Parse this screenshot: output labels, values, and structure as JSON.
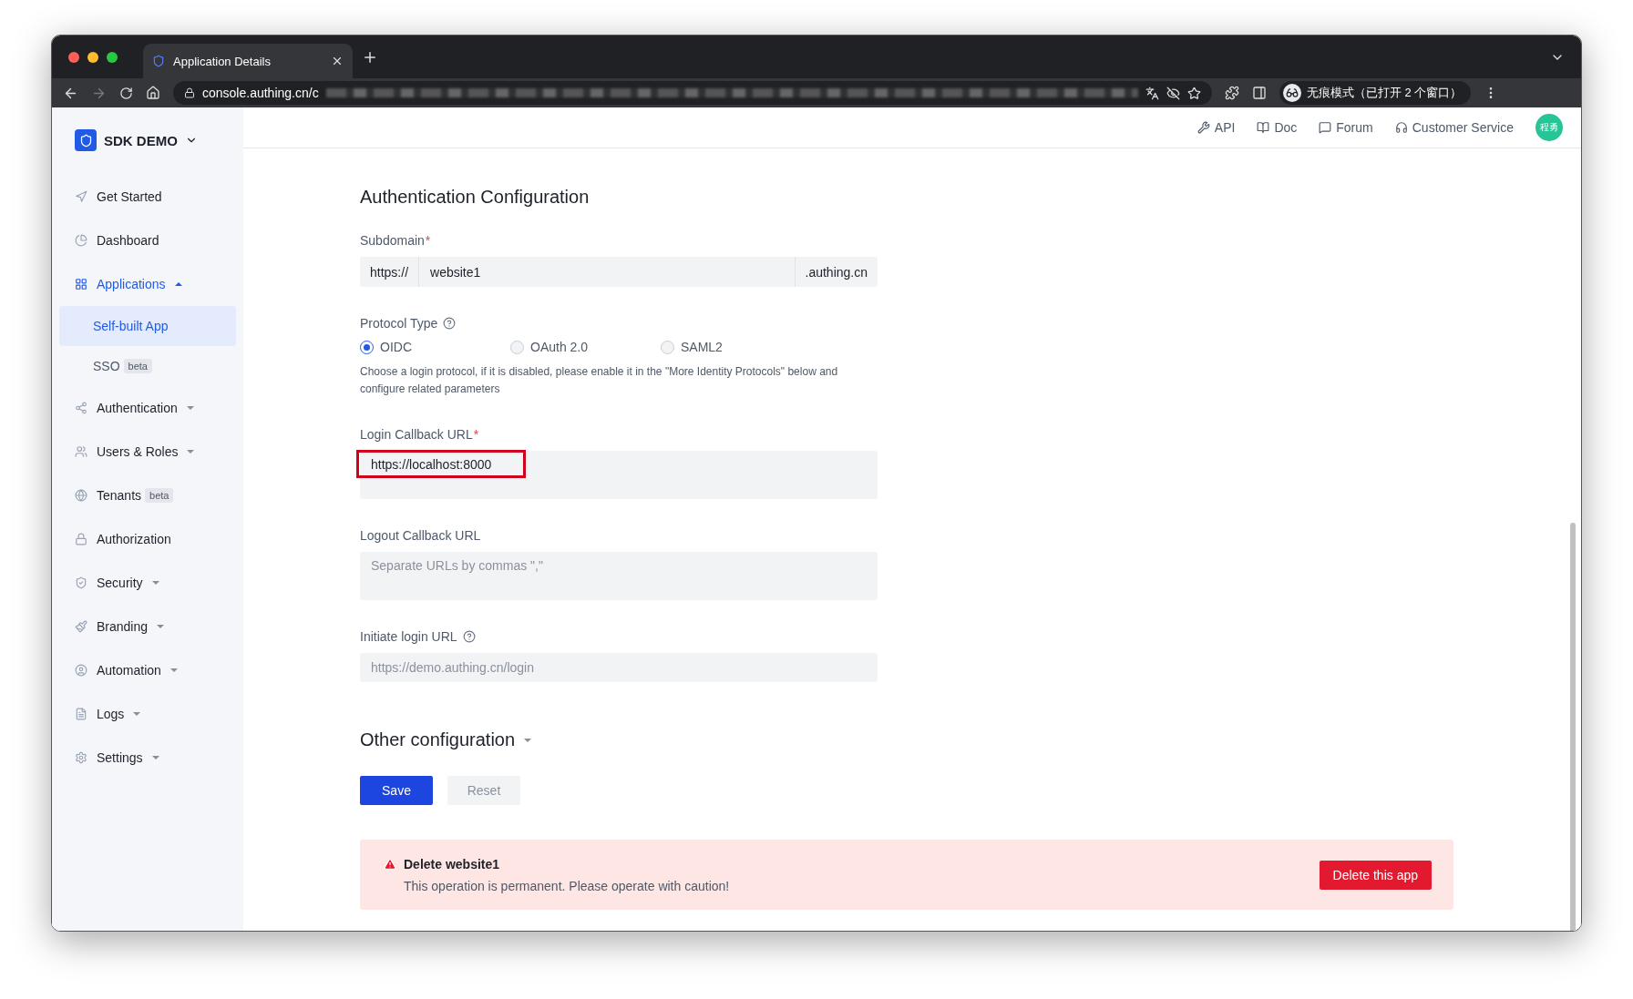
{
  "browser": {
    "tabs": [
      {
        "title": "Application Details",
        "selected": true
      }
    ],
    "url": "console.authing.cn/c",
    "profile_label": "无痕模式（已打开 2 个窗口）"
  },
  "sidebar": {
    "brand": "SDK DEMO",
    "items": [
      {
        "label": "Get Started",
        "selected": false
      },
      {
        "label": "Dashboard",
        "selected": false
      },
      {
        "label": "Applications",
        "selected": true,
        "expanded": true,
        "children": [
          {
            "label": "Self-built App",
            "selected": true
          },
          {
            "label": "SSO",
            "badge": "beta",
            "selected": false
          }
        ]
      },
      {
        "label": "Authentication",
        "selected": false,
        "expanded": false
      },
      {
        "label": "Users & Roles",
        "selected": false,
        "expanded": false
      },
      {
        "label": "Tenants",
        "badge": "beta",
        "selected": false
      },
      {
        "label": "Authorization",
        "selected": false
      },
      {
        "label": "Security",
        "selected": false,
        "expanded": false
      },
      {
        "label": "Branding",
        "selected": false,
        "expanded": false
      },
      {
        "label": "Automation",
        "selected": false,
        "expanded": false
      },
      {
        "label": "Logs",
        "selected": false,
        "expanded": false
      },
      {
        "label": "Settings",
        "selected": false,
        "expanded": false
      }
    ]
  },
  "header": {
    "links": [
      {
        "label": "API"
      },
      {
        "label": "Doc"
      },
      {
        "label": "Forum"
      },
      {
        "label": "Customer Service"
      }
    ],
    "avatar": "程勇"
  },
  "form": {
    "title": "Authentication Configuration",
    "subdomain": {
      "label": "Subdomain",
      "required_mark": "*",
      "prefix": "https://",
      "value": "website1",
      "suffix": ".authing.cn"
    },
    "protocol": {
      "label": "Protocol Type",
      "options": [
        {
          "label": "OIDC",
          "selected": true
        },
        {
          "label": "OAuth 2.0",
          "selected": false
        },
        {
          "label": "SAML2",
          "selected": false
        }
      ],
      "hint": "Choose a login protocol, if it is disabled, please enable it in the \"More Identity Protocols\" below and configure related parameters"
    },
    "login_callback": {
      "label": "Login Callback URL",
      "required_mark": "*",
      "value": "https://localhost:8000",
      "highlighted": true
    },
    "logout_callback": {
      "label": "Logout Callback URL",
      "placeholder": "Separate URLs by commas \",\""
    },
    "initiate_login": {
      "label": "Initiate login URL",
      "placeholder": "https://demo.authing.cn/login"
    },
    "other_config": {
      "label": "Other configuration",
      "expanded": false
    },
    "buttons": [
      {
        "label": "Save",
        "kind": "primary",
        "disabled": false
      },
      {
        "label": "Reset",
        "kind": "default",
        "disabled": true
      }
    ]
  },
  "danger": {
    "title": "Delete website1",
    "message": "This operation is permanent. Please operate with caution!",
    "button": "Delete this app"
  }
}
